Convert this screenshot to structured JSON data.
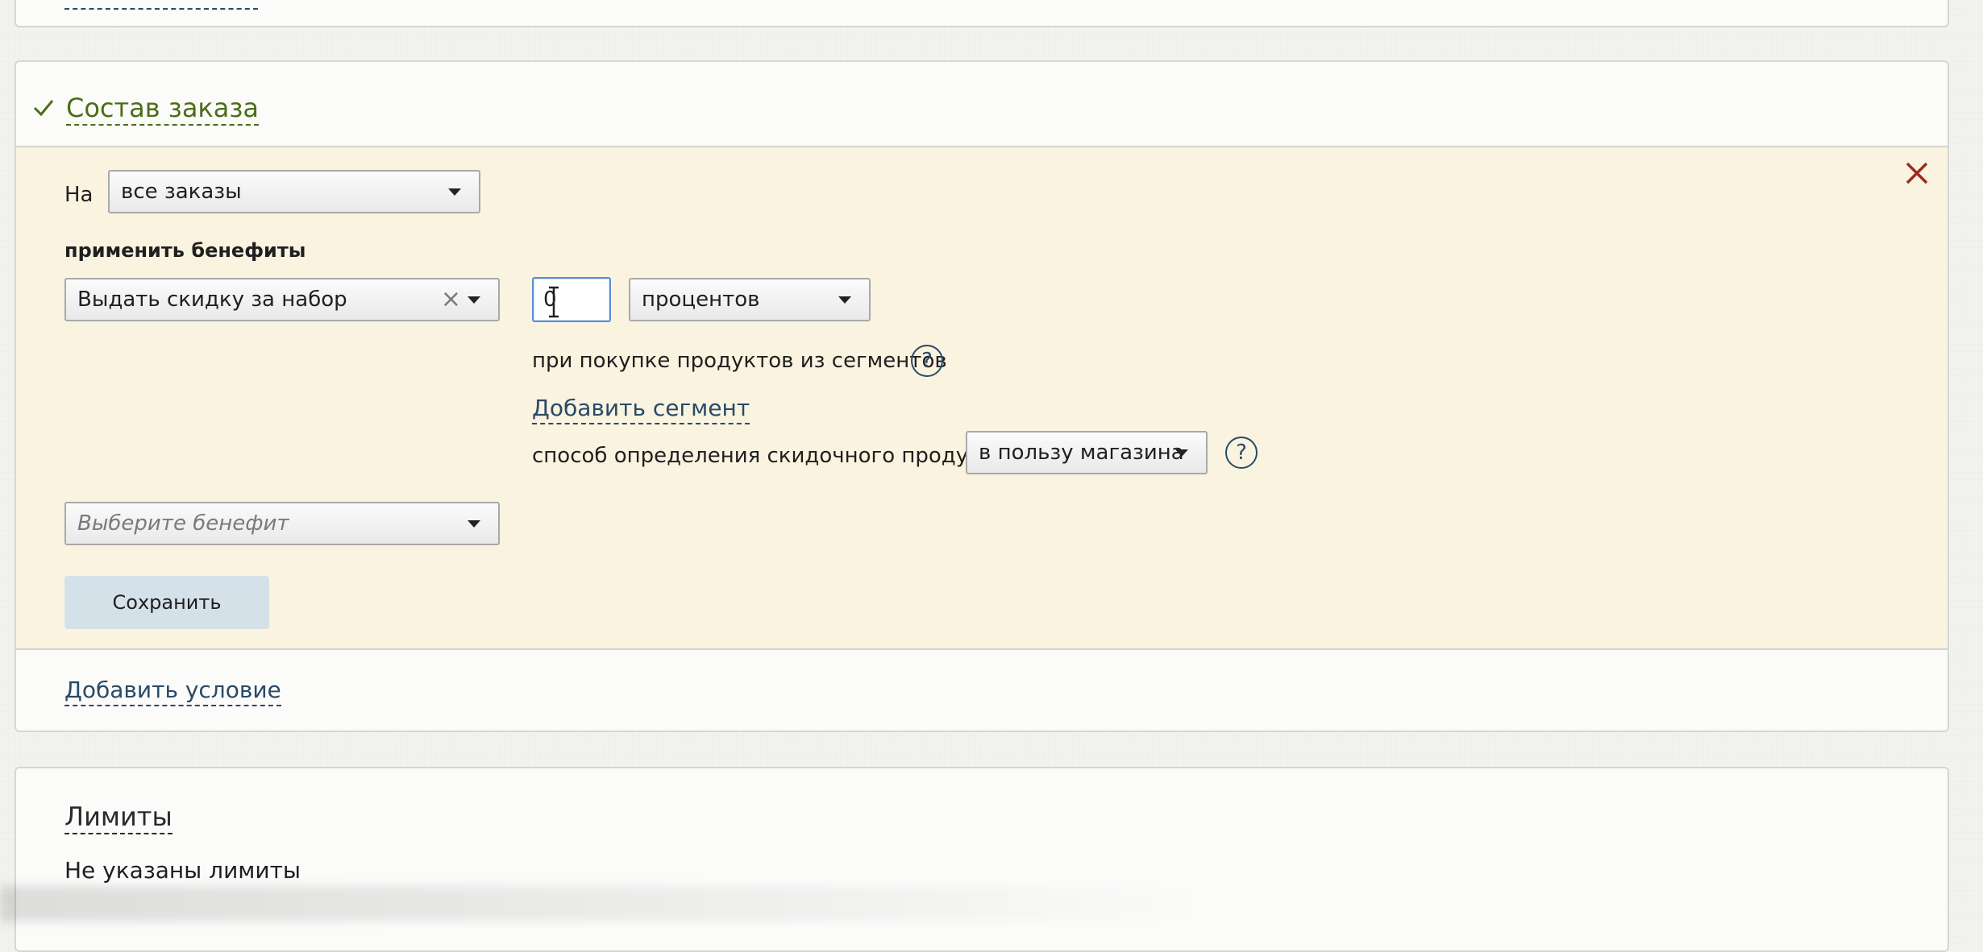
{
  "order_section": {
    "title": "Состав заказа",
    "on_label": "На",
    "orders_select": "все заказы",
    "apply_benefits_label": "применить бенефиты",
    "benefit_select": "Выдать скидку за набор",
    "discount_value": "0",
    "unit_select": "процентов",
    "segments_label": "при покупке продуктов из сегментов",
    "help_glyph": "?",
    "add_segment_link": "Добавить сегмент",
    "method_label": "способ определения скидочного продукта",
    "method_select": "в пользу магазина",
    "choose_benefit_placeholder": "Выберите бенефит",
    "save_button": "Сохранить",
    "add_condition_link": "Добавить условие",
    "clear_glyph": "×"
  },
  "limits_section": {
    "title": "Лимиты",
    "text": "Не указаны лимиты"
  },
  "colors": {
    "accent_green": "#4b6e18",
    "link_blue": "#2a4a66",
    "close_red": "#9b2b1f",
    "panel_bg": "#f9f3e0",
    "save_bg": "#d5e1e8"
  }
}
